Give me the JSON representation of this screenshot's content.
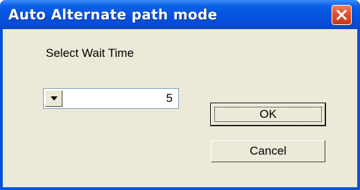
{
  "window": {
    "title": "Auto Alternate path mode",
    "close_icon": "close-icon"
  },
  "dialog": {
    "prompt_label": "Select Wait Time",
    "wait_time": {
      "value": "5",
      "arrow_icon": "chevron-down-icon"
    },
    "ok_label": "OK",
    "cancel_label": "Cancel"
  },
  "colors": {
    "titlebar": "#0a5ee6",
    "client": "#ece9d8",
    "close_button": "#e0502c"
  }
}
